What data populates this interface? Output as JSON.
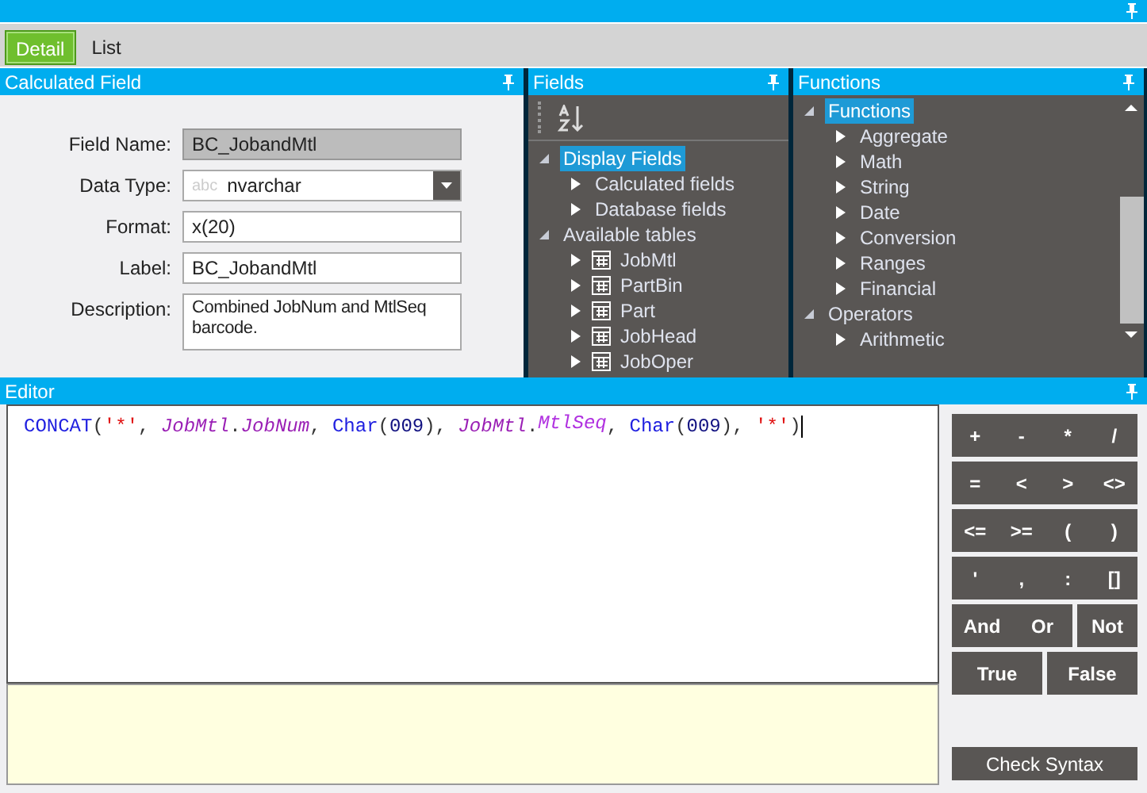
{
  "tabs": [
    {
      "label": "Detail",
      "selected": true
    },
    {
      "label": "List",
      "selected": false
    }
  ],
  "calculated_field": {
    "title": "Calculated Field",
    "fields": [
      {
        "kind": "readonly",
        "label": "Field Name:",
        "value": "BC_JobandMtl"
      },
      {
        "kind": "dropdown",
        "label": "Data Type:",
        "type_hint": "abc",
        "value": "nvarchar"
      },
      {
        "kind": "text",
        "label": "Format:",
        "value": "x(20)"
      },
      {
        "kind": "text",
        "label": "Label:",
        "value": "BC_JobandMtl"
      },
      {
        "kind": "textarea",
        "label": "Description:",
        "value": "Combined JobNum and MtlSeq barcode."
      }
    ]
  },
  "fields": {
    "title": "Fields",
    "tree": [
      {
        "label": "Display Fields",
        "selected": true,
        "expanded": true,
        "children": [
          {
            "label": "Calculated fields",
            "kind": "folder",
            "expanded": false
          },
          {
            "label": "Database fields",
            "kind": "folder",
            "expanded": false
          }
        ]
      },
      {
        "label": "Available tables",
        "selected": false,
        "expanded": true,
        "children": [
          {
            "label": "JobMtl",
            "kind": "table",
            "expanded": false
          },
          {
            "label": "PartBin",
            "kind": "table",
            "expanded": false
          },
          {
            "label": "Part",
            "kind": "table",
            "expanded": false
          },
          {
            "label": "JobHead",
            "kind": "table",
            "expanded": false
          },
          {
            "label": "JobOper",
            "kind": "table",
            "expanded": false
          }
        ]
      }
    ]
  },
  "functions": {
    "title": "Functions",
    "tree": [
      {
        "label": "Functions",
        "selected": true,
        "expanded": true,
        "children": [
          {
            "label": "Aggregate",
            "expanded": false
          },
          {
            "label": "Math",
            "expanded": false
          },
          {
            "label": "String",
            "expanded": false
          },
          {
            "label": "Date",
            "expanded": false
          },
          {
            "label": "Conversion",
            "expanded": false
          },
          {
            "label": "Ranges",
            "expanded": false
          },
          {
            "label": "Financial",
            "expanded": false
          }
        ]
      },
      {
        "label": "Operators",
        "selected": false,
        "expanded": true,
        "children": [
          {
            "label": "Arithmetic",
            "expanded": false
          }
        ]
      }
    ]
  },
  "editor": {
    "title": "Editor",
    "code": [
      {
        "kind": "function",
        "text": "CONCAT"
      },
      {
        "kind": "punct",
        "text": "("
      },
      {
        "kind": "string",
        "text": "'*'"
      },
      {
        "kind": "punct",
        "text": ", "
      },
      {
        "kind": "table",
        "text": "JobMtl"
      },
      {
        "kind": "punct",
        "text": "."
      },
      {
        "kind": "table",
        "text": "JobNum"
      },
      {
        "kind": "punct",
        "text": ", "
      },
      {
        "kind": "function",
        "text": "Char"
      },
      {
        "kind": "punct",
        "text": "("
      },
      {
        "kind": "number",
        "text": "009"
      },
      {
        "kind": "punct",
        "text": "), "
      },
      {
        "kind": "table",
        "text": "JobMtl"
      },
      {
        "kind": "punct",
        "text": "."
      },
      {
        "kind": "column",
        "text": "MtlSeq"
      },
      {
        "kind": "punct",
        "text": ", "
      },
      {
        "kind": "function",
        "text": "Char"
      },
      {
        "kind": "punct",
        "text": "("
      },
      {
        "kind": "number",
        "text": "009"
      },
      {
        "kind": "punct",
        "text": "), "
      },
      {
        "kind": "string",
        "text": "'*'"
      },
      {
        "kind": "punct",
        "text": ")"
      }
    ],
    "keypad": [
      [
        "+",
        "-",
        "*",
        "/"
      ],
      [
        "=",
        "<",
        ">",
        "<>"
      ],
      [
        "<=",
        ">=",
        "(",
        ")"
      ],
      [
        "'",
        ",",
        ":",
        "[]"
      ],
      [
        "And",
        "Or",
        "Not"
      ],
      [
        "True",
        "False"
      ]
    ],
    "check_button": "Check Syntax"
  }
}
